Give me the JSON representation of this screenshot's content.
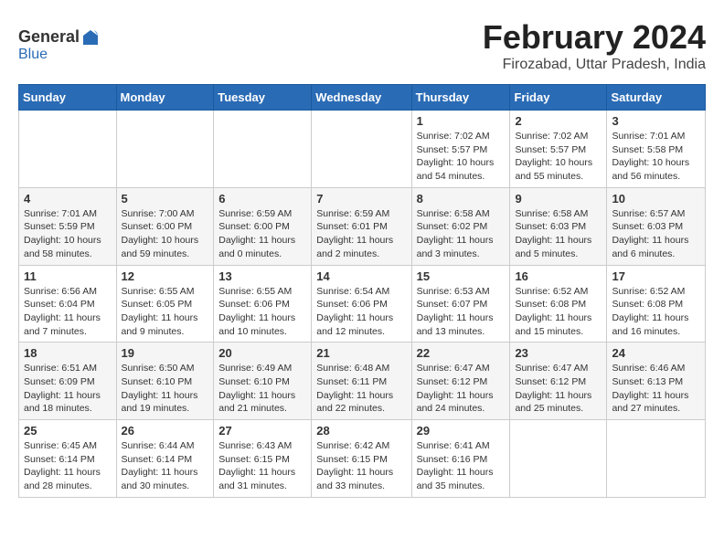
{
  "logo": {
    "general": "General",
    "blue": "Blue"
  },
  "header": {
    "title": "February 2024",
    "subtitle": "Firozabad, Uttar Pradesh, India"
  },
  "weekdays": [
    "Sunday",
    "Monday",
    "Tuesday",
    "Wednesday",
    "Thursday",
    "Friday",
    "Saturday"
  ],
  "weeks": [
    [
      {
        "day": "",
        "info": ""
      },
      {
        "day": "",
        "info": ""
      },
      {
        "day": "",
        "info": ""
      },
      {
        "day": "",
        "info": ""
      },
      {
        "day": "1",
        "info": "Sunrise: 7:02 AM\nSunset: 5:57 PM\nDaylight: 10 hours\nand 54 minutes."
      },
      {
        "day": "2",
        "info": "Sunrise: 7:02 AM\nSunset: 5:57 PM\nDaylight: 10 hours\nand 55 minutes."
      },
      {
        "day": "3",
        "info": "Sunrise: 7:01 AM\nSunset: 5:58 PM\nDaylight: 10 hours\nand 56 minutes."
      }
    ],
    [
      {
        "day": "4",
        "info": "Sunrise: 7:01 AM\nSunset: 5:59 PM\nDaylight: 10 hours\nand 58 minutes."
      },
      {
        "day": "5",
        "info": "Sunrise: 7:00 AM\nSunset: 6:00 PM\nDaylight: 10 hours\nand 59 minutes."
      },
      {
        "day": "6",
        "info": "Sunrise: 6:59 AM\nSunset: 6:00 PM\nDaylight: 11 hours\nand 0 minutes."
      },
      {
        "day": "7",
        "info": "Sunrise: 6:59 AM\nSunset: 6:01 PM\nDaylight: 11 hours\nand 2 minutes."
      },
      {
        "day": "8",
        "info": "Sunrise: 6:58 AM\nSunset: 6:02 PM\nDaylight: 11 hours\nand 3 minutes."
      },
      {
        "day": "9",
        "info": "Sunrise: 6:58 AM\nSunset: 6:03 PM\nDaylight: 11 hours\nand 5 minutes."
      },
      {
        "day": "10",
        "info": "Sunrise: 6:57 AM\nSunset: 6:03 PM\nDaylight: 11 hours\nand 6 minutes."
      }
    ],
    [
      {
        "day": "11",
        "info": "Sunrise: 6:56 AM\nSunset: 6:04 PM\nDaylight: 11 hours\nand 7 minutes."
      },
      {
        "day": "12",
        "info": "Sunrise: 6:55 AM\nSunset: 6:05 PM\nDaylight: 11 hours\nand 9 minutes."
      },
      {
        "day": "13",
        "info": "Sunrise: 6:55 AM\nSunset: 6:06 PM\nDaylight: 11 hours\nand 10 minutes."
      },
      {
        "day": "14",
        "info": "Sunrise: 6:54 AM\nSunset: 6:06 PM\nDaylight: 11 hours\nand 12 minutes."
      },
      {
        "day": "15",
        "info": "Sunrise: 6:53 AM\nSunset: 6:07 PM\nDaylight: 11 hours\nand 13 minutes."
      },
      {
        "day": "16",
        "info": "Sunrise: 6:52 AM\nSunset: 6:08 PM\nDaylight: 11 hours\nand 15 minutes."
      },
      {
        "day": "17",
        "info": "Sunrise: 6:52 AM\nSunset: 6:08 PM\nDaylight: 11 hours\nand 16 minutes."
      }
    ],
    [
      {
        "day": "18",
        "info": "Sunrise: 6:51 AM\nSunset: 6:09 PM\nDaylight: 11 hours\nand 18 minutes."
      },
      {
        "day": "19",
        "info": "Sunrise: 6:50 AM\nSunset: 6:10 PM\nDaylight: 11 hours\nand 19 minutes."
      },
      {
        "day": "20",
        "info": "Sunrise: 6:49 AM\nSunset: 6:10 PM\nDaylight: 11 hours\nand 21 minutes."
      },
      {
        "day": "21",
        "info": "Sunrise: 6:48 AM\nSunset: 6:11 PM\nDaylight: 11 hours\nand 22 minutes."
      },
      {
        "day": "22",
        "info": "Sunrise: 6:47 AM\nSunset: 6:12 PM\nDaylight: 11 hours\nand 24 minutes."
      },
      {
        "day": "23",
        "info": "Sunrise: 6:47 AM\nSunset: 6:12 PM\nDaylight: 11 hours\nand 25 minutes."
      },
      {
        "day": "24",
        "info": "Sunrise: 6:46 AM\nSunset: 6:13 PM\nDaylight: 11 hours\nand 27 minutes."
      }
    ],
    [
      {
        "day": "25",
        "info": "Sunrise: 6:45 AM\nSunset: 6:14 PM\nDaylight: 11 hours\nand 28 minutes."
      },
      {
        "day": "26",
        "info": "Sunrise: 6:44 AM\nSunset: 6:14 PM\nDaylight: 11 hours\nand 30 minutes."
      },
      {
        "day": "27",
        "info": "Sunrise: 6:43 AM\nSunset: 6:15 PM\nDaylight: 11 hours\nand 31 minutes."
      },
      {
        "day": "28",
        "info": "Sunrise: 6:42 AM\nSunset: 6:15 PM\nDaylight: 11 hours\nand 33 minutes."
      },
      {
        "day": "29",
        "info": "Sunrise: 6:41 AM\nSunset: 6:16 PM\nDaylight: 11 hours\nand 35 minutes."
      },
      {
        "day": "",
        "info": ""
      },
      {
        "day": "",
        "info": ""
      }
    ]
  ]
}
